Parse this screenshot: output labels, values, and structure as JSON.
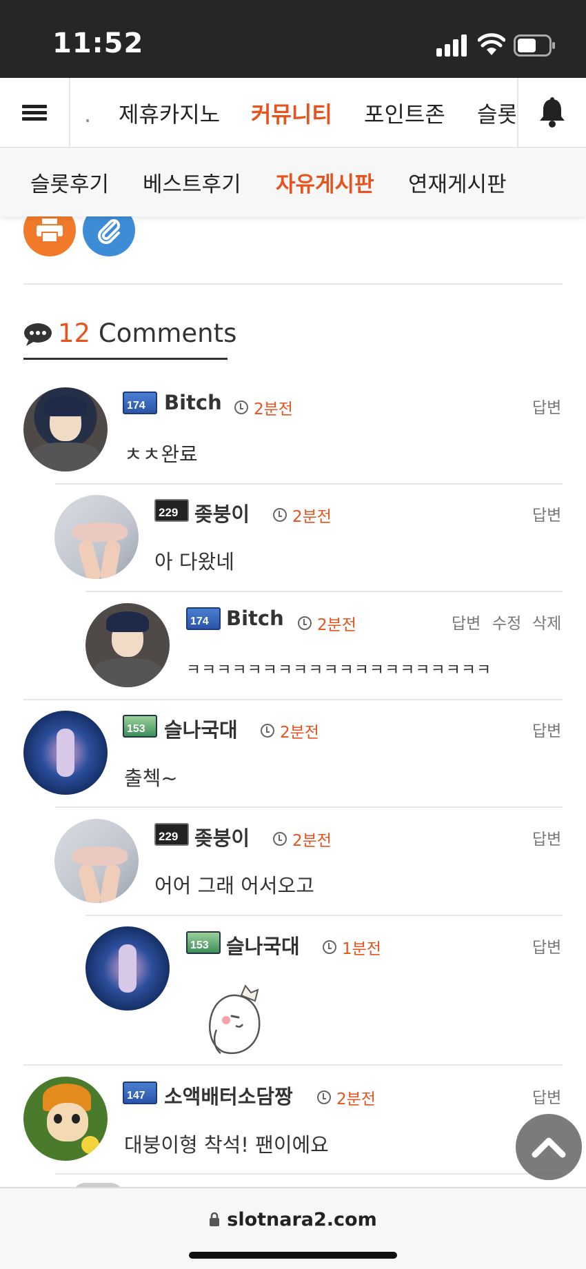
{
  "status_bar": {
    "time": "11:52"
  },
  "top_nav": {
    "tabs": [
      {
        "label": "."
      },
      {
        "label": "제휴카지노"
      },
      {
        "label": "커뮤니티",
        "active": true
      },
      {
        "label": "포인트존"
      },
      {
        "label": "슬롯"
      }
    ],
    "icons": [
      "menu-icon",
      "bell-icon"
    ]
  },
  "sub_nav": {
    "tabs": [
      {
        "label": "슬롯후기"
      },
      {
        "label": "베스트후기"
      },
      {
        "label": "자유게시판",
        "active": true
      },
      {
        "label": "연재게시판"
      }
    ]
  },
  "actions": {
    "print_color": "#f07a2a",
    "attach_color": "#3f8cd6"
  },
  "comments_header": {
    "count": "12",
    "label": "Comments"
  },
  "comments": [
    {
      "name": "Bitch",
      "level": "174",
      "time": "2분전",
      "text": "ㅊㅊ완료",
      "actions": [
        "답변"
      ]
    },
    {
      "name": "좆붕이",
      "level": "229",
      "time": "2분전",
      "text": "아 다왔네",
      "actions": [
        "답변"
      ]
    },
    {
      "name": "Bitch",
      "level": "174",
      "time": "2분전",
      "text": "ㅋㅋㅋㅋㅋㅋㅋㅋㅋㅋㅋㅋㅋㅋㅋㅋㅋㅋㅋㅋ",
      "actions": [
        "답변",
        "수정",
        "삭제"
      ]
    },
    {
      "name": "슬나국대",
      "level": "153",
      "time": "2분전",
      "text": "출첵~",
      "actions": [
        "답변"
      ]
    },
    {
      "name": "좆붕이",
      "level": "229",
      "time": "2분전",
      "text": "어어 그래 어서오고",
      "actions": [
        "답변"
      ]
    },
    {
      "name": "슬나국대",
      "level": "153",
      "time": "1분전",
      "text": "",
      "actions": [
        "답변"
      ]
    },
    {
      "name": "소액배터소담짱",
      "level": "147",
      "time": "2분전",
      "text": "대붕이형 착석! 팬이에요",
      "actions": [
        "답변"
      ]
    }
  ],
  "url_bar": {
    "url": "slotnara2.com"
  },
  "colors": {
    "accent": "#e8531d",
    "status_bg": "#262626"
  }
}
